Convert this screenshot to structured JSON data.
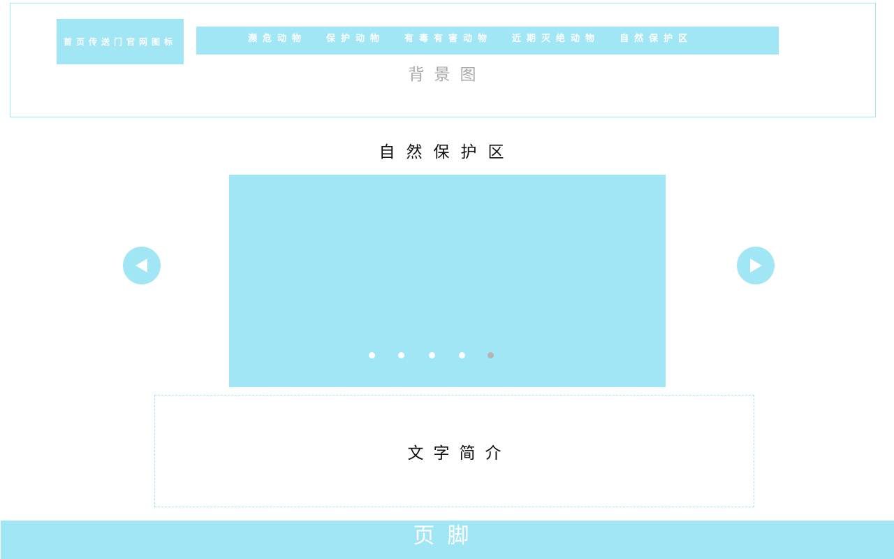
{
  "header": {
    "logo_text": "首页传送门官网图标",
    "background_label": "背景图",
    "nav": [
      {
        "label": "濒危动物"
      },
      {
        "label": "保护动物"
      },
      {
        "label": "有毒有害动物"
      },
      {
        "label": "近期灭绝动物"
      },
      {
        "label": "自然保护区"
      }
    ]
  },
  "main": {
    "section_title": "自然保护区",
    "carousel": {
      "indicator_count": 5,
      "active_index": 4,
      "prev_icon": "triangle-left-icon",
      "next_icon": "triangle-right-icon"
    },
    "intro_text": "文字简介"
  },
  "footer": {
    "label": "页脚"
  },
  "colors": {
    "accent": "#a0e6f5",
    "muted_text": "#a8a8a8",
    "text": "#111111",
    "inactive_dot": "#ffffff",
    "active_dot": "#b4b4b4"
  }
}
